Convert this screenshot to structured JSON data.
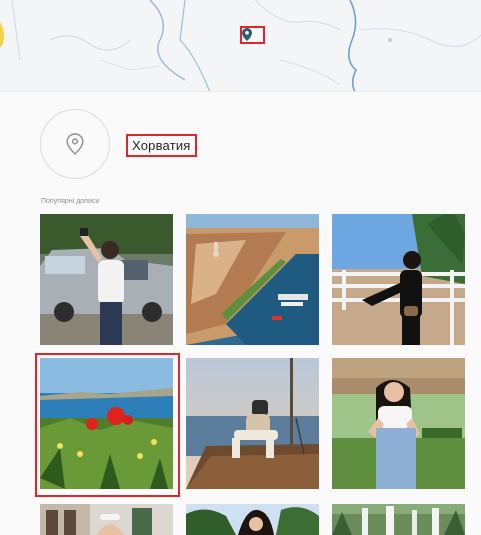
{
  "location": {
    "title": "Хорватия",
    "icon": "location-pin-icon"
  },
  "section": {
    "label": "Популярні дописи"
  },
  "map": {
    "pin_icon": "map-marker-icon",
    "pin_color": "#2f5e73"
  },
  "posts": [
    {
      "id": "post-1",
      "subject": "woman taking selfie by car"
    },
    {
      "id": "post-2",
      "subject": "aerial city harbor"
    },
    {
      "id": "post-3",
      "subject": "woman on fence"
    },
    {
      "id": "post-4",
      "subject": "poppies by the sea",
      "selected": true
    },
    {
      "id": "post-5",
      "subject": "man on boat at sunset"
    },
    {
      "id": "post-6",
      "subject": "woman in white top"
    },
    {
      "id": "post-7",
      "subject": "woman on balcony"
    },
    {
      "id": "post-8",
      "subject": "woman with trees"
    },
    {
      "id": "post-9",
      "subject": "waterfall"
    }
  ],
  "colors": {
    "highlight": "#e0262b",
    "muted_text": "#8e8e8e",
    "border": "#dbdbdb"
  }
}
